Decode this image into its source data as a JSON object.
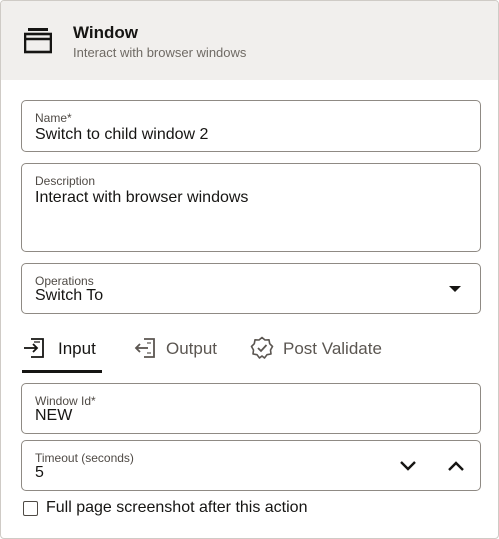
{
  "header": {
    "title": "Window",
    "subtitle": "Interact with browser windows",
    "icon": "window-stack-icon"
  },
  "form": {
    "name": {
      "label": "Name*",
      "value": "Switch to child window 2"
    },
    "description": {
      "label": "Description",
      "value": "Interact with browser windows"
    },
    "operations": {
      "label": "Operations",
      "value": "Switch To"
    }
  },
  "tabs": [
    {
      "label": "Input",
      "icon": "input-icon",
      "active": true
    },
    {
      "label": "Output",
      "icon": "output-icon",
      "active": false
    },
    {
      "label": "Post Validate",
      "icon": "post-validate-icon",
      "active": false
    }
  ],
  "input": {
    "window_id": {
      "label": "Window Id*",
      "value": "NEW"
    },
    "timeout": {
      "label": "Timeout (seconds)",
      "value": "5"
    }
  },
  "screenshot_option": {
    "label": "Full page screenshot after this action",
    "checked": false
  },
  "colors": {
    "header_bg": "#f1efed",
    "border": "#8f8a84",
    "text": "#161513",
    "muted": "#6f6a64"
  }
}
